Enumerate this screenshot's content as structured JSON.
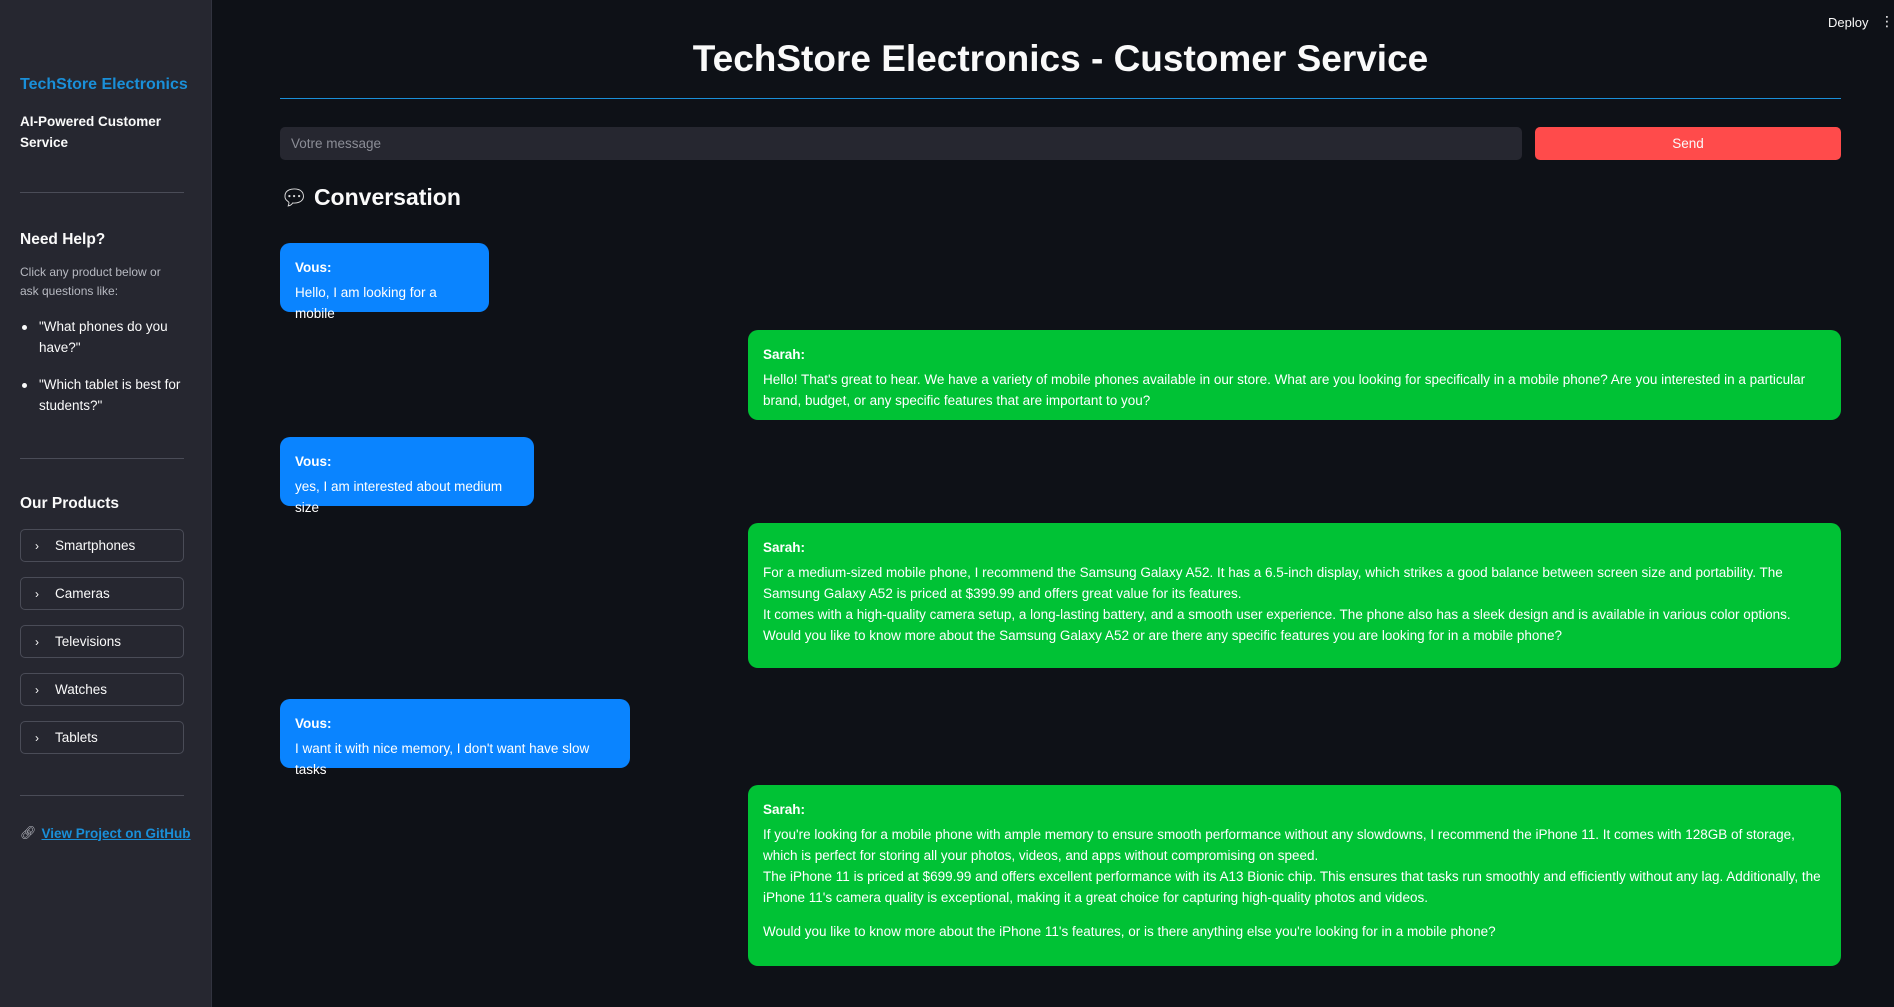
{
  "topbar": {
    "deploy_label": "Deploy"
  },
  "sidebar": {
    "brand": "TechStore Electronics",
    "tagline": "AI-Powered Customer Service",
    "help_title": "Need Help?",
    "help_text": "Click any product below or ask questions like:",
    "help_examples": [
      "\"What phones do you have?\"",
      "\"Which tablet is best for students?\""
    ],
    "products_title": "Our Products",
    "products": [
      "Smartphones",
      "Cameras",
      "Televisions",
      "Watches",
      "Tablets"
    ],
    "github_link": "View Project on GitHub"
  },
  "main": {
    "title": "TechStore Electronics - Customer Service",
    "input_placeholder": "Votre message",
    "send_label": "Send",
    "conversation_title": "Conversation"
  },
  "messages": [
    {
      "sender": "Vous:",
      "paragraphs": [
        "Hello, I am looking for a mobile"
      ]
    },
    {
      "sender": "Sarah:",
      "paragraphs": [
        "Hello! That's great to hear. We have a variety of mobile phones available in our store. What are you looking for specifically in a mobile phone? Are you interested in a particular brand, budget, or any specific features that are important to you?"
      ]
    },
    {
      "sender": "Vous:",
      "paragraphs": [
        "yes, I am interested about medium size"
      ]
    },
    {
      "sender": "Sarah:",
      "paragraphs": [
        "For a medium-sized mobile phone, I recommend the Samsung Galaxy A52. It has a 6.5-inch display, which strikes a good balance between screen size and portability. The Samsung Galaxy A52 is priced at $399.99 and offers great value for its features.",
        "It comes with a high-quality camera setup, a long-lasting battery, and a smooth user experience. The phone also has a sleek design and is available in various color options. Would you like to know more about the Samsung Galaxy A52 or are there any specific features you are looking for in a mobile phone?"
      ]
    },
    {
      "sender": "Vous:",
      "paragraphs": [
        "I want it with nice memory, I don't want have slow tasks"
      ]
    },
    {
      "sender": "Sarah:",
      "paragraphs": [
        "If you're looking for a mobile phone with ample memory to ensure smooth performance without any slowdowns, I recommend the iPhone 11. It comes with 128GB of storage, which is perfect for storing all your photos, videos, and apps without compromising on speed.",
        "The iPhone 11 is priced at $699.99 and offers excellent performance with its A13 Bionic chip. This ensures that tasks run smoothly and efficiently without any lag. Additionally, the iPhone 11's camera quality is exceptional, making it a great choice for capturing high-quality photos and videos.",
        "Would you like to know more about the iPhone 11's features, or is there anything else you're looking for in a mobile phone?"
      ]
    }
  ]
}
